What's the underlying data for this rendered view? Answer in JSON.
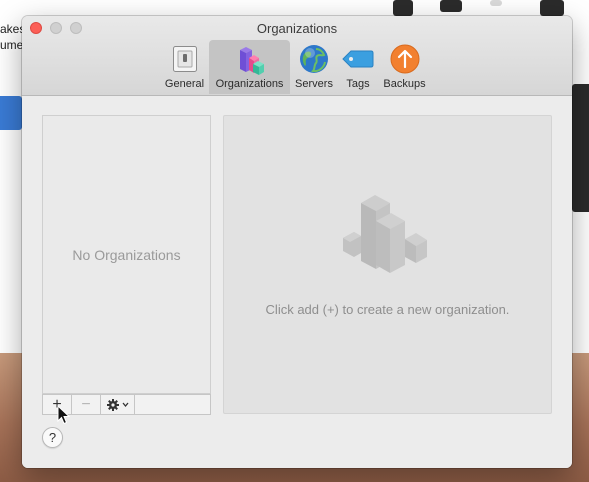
{
  "background": {
    "snippets": [
      "akes",
      "umer"
    ]
  },
  "window": {
    "title": "Organizations"
  },
  "toolbar": {
    "tabs": [
      {
        "label": "General",
        "icon": "switch-icon",
        "active": false
      },
      {
        "label": "Organizations",
        "icon": "organizations-blocks-icon",
        "active": true
      },
      {
        "label": "Servers",
        "icon": "globe-icon",
        "active": false
      },
      {
        "label": "Tags",
        "icon": "tag-icon",
        "active": false
      },
      {
        "label": "Backups",
        "icon": "backup-arrow-icon",
        "active": false
      }
    ]
  },
  "list": {
    "empty_text": "No Organizations",
    "add_label": "+",
    "remove_label": "−",
    "action_icon": "gear-icon"
  },
  "detail": {
    "hint_text": "Click add (+) to create a new organization."
  },
  "help": {
    "label": "?"
  },
  "colors": {
    "accent_blue": "#3a7bd5",
    "close_red": "#fc5f57",
    "backup_orange": "#f2802f",
    "tag_blue": "#3b9fe0"
  }
}
